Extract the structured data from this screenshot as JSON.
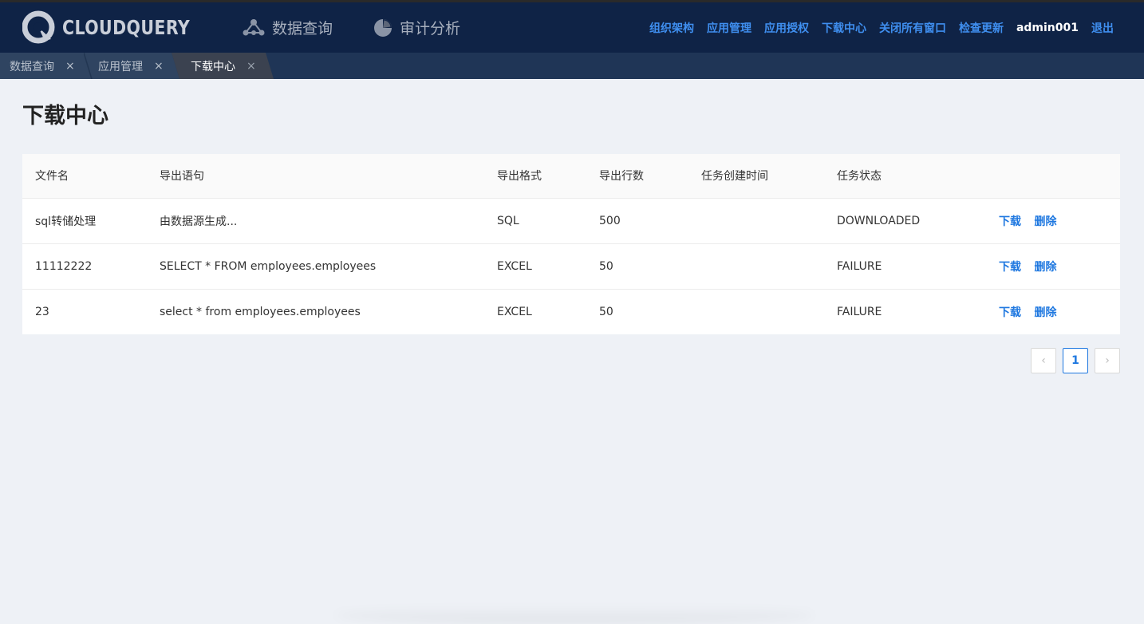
{
  "brand": {
    "name": "CLOUDQUERY"
  },
  "main_nav": [
    {
      "label": "数据查询",
      "icon": "network-nodes-icon"
    },
    {
      "label": "审计分析",
      "icon": "pie-chart-icon"
    }
  ],
  "top_nav": {
    "links": [
      "组织架构",
      "应用管理",
      "应用授权",
      "下载中心",
      "关闭所有窗口",
      "检查更新"
    ],
    "user": "admin001",
    "logout": "退出"
  },
  "tabs": [
    {
      "label": "数据查询",
      "close": "×",
      "active": false
    },
    {
      "label": "应用管理",
      "close": "×",
      "active": false
    },
    {
      "label": "下载中心",
      "close": "×",
      "active": true
    }
  ],
  "page": {
    "title": "下载中心"
  },
  "table": {
    "columns": [
      "文件名",
      "导出语句",
      "导出格式",
      "导出行数",
      "任务创建时间",
      "任务状态",
      ""
    ],
    "rows": [
      {
        "file": "sql转储处理",
        "statement": "由数据源生成...",
        "format": "SQL",
        "rows": "500",
        "created": "",
        "status": "DOWNLOADED",
        "download": "下载",
        "delete": "删除"
      },
      {
        "file": "11112222",
        "statement": "SELECT * FROM employees.employees",
        "format": "EXCEL",
        "rows": "50",
        "created": "",
        "status": "FAILURE",
        "download": "下载",
        "delete": "删除"
      },
      {
        "file": "23",
        "statement": "select * from employees.employees",
        "format": "EXCEL",
        "rows": "50",
        "created": "",
        "status": "FAILURE",
        "download": "下载",
        "delete": "删除"
      }
    ]
  },
  "pagination": {
    "prev": "‹",
    "current": "1",
    "next": "›"
  },
  "colors": {
    "header_bg": "#0f2346",
    "tabbar_bg": "#1f3556",
    "link": "#3f8ff0",
    "action": "#1f78e0"
  }
}
